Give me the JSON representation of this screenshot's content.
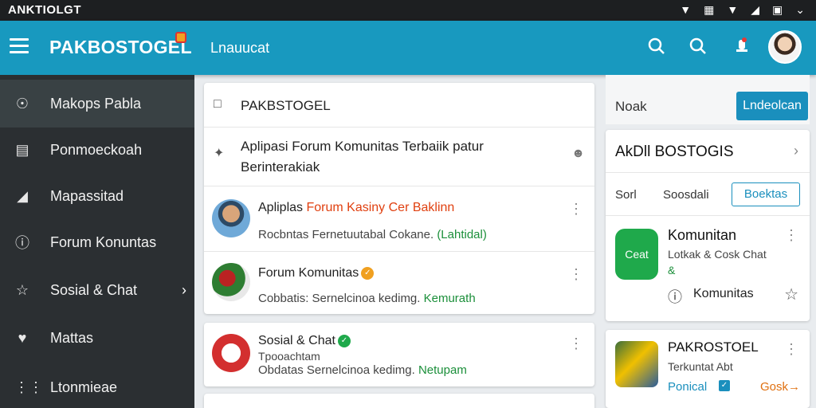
{
  "status_bar": {
    "title": "ANKTIOLGT",
    "icons": [
      "signal-icon",
      "sim-icon",
      "wifi-icon",
      "battery-icon",
      "rotate-icon",
      "dropdown-icon"
    ]
  },
  "app_bar": {
    "brand": "PAKBOSTOGEL",
    "subtitle": "Lnauucat",
    "actions": [
      "search-icon",
      "search-icon",
      "notification-icon"
    ]
  },
  "sidebar": {
    "items": [
      {
        "label": "Makops Pabla",
        "icon": "user-icon"
      },
      {
        "label": "Ponmoeckoah",
        "icon": "bag-icon"
      },
      {
        "label": "Mapassitad",
        "icon": "image-icon"
      },
      {
        "label": "Forum Konuntas",
        "icon": "alert-icon"
      },
      {
        "label": "Sosial & Chat",
        "icon": "star-icon"
      },
      {
        "label": "Mattas",
        "icon": "heart-icon"
      },
      {
        "label": "Ltonmieae",
        "icon": "grid-icon"
      }
    ]
  },
  "feed": {
    "header": {
      "title": "PAKBSTOGEL"
    },
    "intro": {
      "text_line1": "Aplipasi Forum Komunitas Terbaiik patur",
      "text_line2": "Berinterakiak"
    },
    "posts": [
      {
        "title_plain": "Apliplas ",
        "title_highlight": "Forum Kasiny Cer Baklinn",
        "sub_plain": "Rocbntas Fernetuutabal Cokane. ",
        "sub_tag": "(Lahtidal)"
      },
      {
        "title_plain": "Forum Komunitas",
        "title_highlight": "",
        "sub_plain": "Cobbatis: Sernelcinoa kedimg. ",
        "sub_tag": "Kemurath"
      },
      {
        "title_plain": "Sosial & Chat",
        "title_highlight": "",
        "sub_extra": "Tpooachtam",
        "sub_plain": "Obdatas Sernelcinoa kedimg. ",
        "sub_tag": "Netupam"
      }
    ]
  },
  "right_panel": {
    "top_text": "Noak",
    "top_button": "Lndeolcan",
    "card1": {
      "title": "AkDll BOSTOGIS",
      "tabs": [
        "Sorl",
        "Soosdali"
      ],
      "tab_button": "Boektas",
      "app_icon_label": "Ceat",
      "item_title": "Komunitan",
      "item_sub": "Lotkak & Cosk Chat",
      "item_sub2": "&",
      "item_footer": "Komunitas"
    },
    "card2": {
      "title": "PAKROSTOEL",
      "sub": "Terkuntat Abt",
      "footer_left": "Ponical",
      "footer_right": "Gosk→"
    }
  },
  "colors": {
    "app_bar": "#1899bf",
    "sidebar": "#2b2f32",
    "accent": "#1a8fbd",
    "highlight": "#e04010",
    "green": "#1b8f3a"
  }
}
